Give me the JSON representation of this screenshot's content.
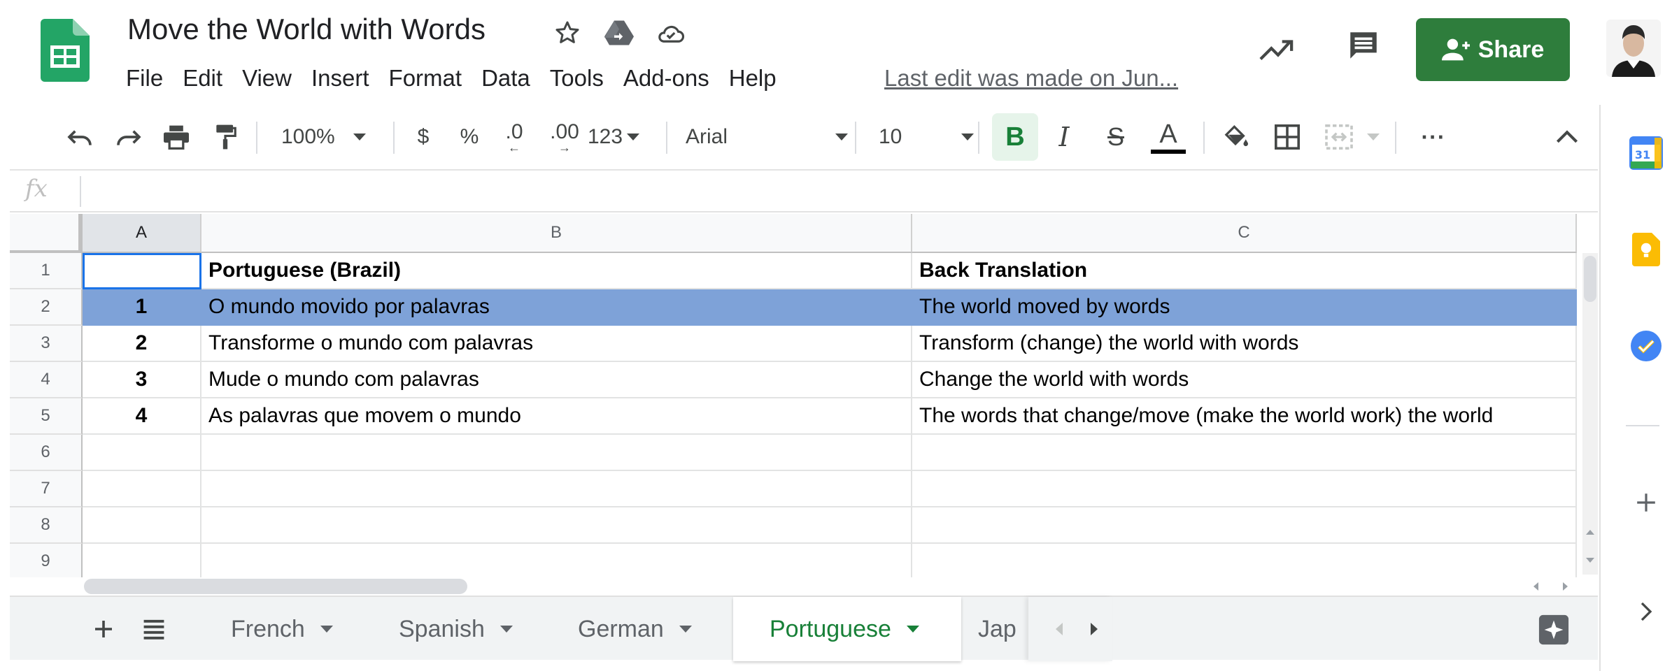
{
  "header": {
    "title": "Move the World with Words",
    "last_edit": "Last edit was made on Jun...",
    "share_label": "Share",
    "menu": [
      "File",
      "Edit",
      "View",
      "Insert",
      "Format",
      "Data",
      "Tools",
      "Add-ons",
      "Help"
    ]
  },
  "toolbar": {
    "zoom": "100%",
    "currency": "$",
    "percent": "%",
    "dec_decrease": ".0",
    "dec_increase": ".00",
    "more_formats": "123",
    "font": "Arial",
    "font_size": "10",
    "bold": "B",
    "italic": "I",
    "strike": "S",
    "text_color": "A",
    "more": "···"
  },
  "formula_bar": {
    "fx": "fx"
  },
  "grid": {
    "columns": [
      "A",
      "B",
      "C"
    ],
    "rows": [
      {
        "num": "1",
        "a": "",
        "b": "Portuguese (Brazil)",
        "c": "Back Translation"
      },
      {
        "num": "2",
        "a": "1",
        "b": "O mundo movido por palavras",
        "c": "The world moved by words"
      },
      {
        "num": "3",
        "a": "2",
        "b": "Transforme o mundo com palavras",
        "c": "Transform (change) the world with words"
      },
      {
        "num": "4",
        "a": "3",
        "b": "Mude o mundo com palavras",
        "c": "Change the world with words"
      },
      {
        "num": "5",
        "a": "4",
        "b": "As palavras que movem o mundo",
        "c": "The words that change/move (make the world work) the world"
      },
      {
        "num": "6",
        "a": "",
        "b": "",
        "c": ""
      },
      {
        "num": "7",
        "a": "",
        "b": "",
        "c": ""
      },
      {
        "num": "8",
        "a": "",
        "b": "",
        "c": ""
      },
      {
        "num": "9",
        "a": "",
        "b": "",
        "c": ""
      }
    ]
  },
  "sheets": {
    "tabs": [
      "French",
      "Spanish",
      "German",
      "Portuguese",
      "Jap"
    ],
    "active": "Portuguese"
  },
  "side_panel": {
    "calendar_day": "31"
  },
  "colors": {
    "share_green": "#2e7d3c",
    "selected_row": "#7ea2d8",
    "active_tab": "#188038"
  },
  "icons": [
    "sheets-logo-icon",
    "star-icon",
    "move-to-drive-icon",
    "cloud-saved-icon",
    "trending-icon",
    "comment-icon",
    "share-person-icon",
    "undo-icon",
    "redo-icon",
    "print-icon",
    "paint-format-icon",
    "fill-color-icon",
    "borders-icon",
    "merge-cells-icon",
    "collapse-icon",
    "add-sheet-icon",
    "all-sheets-icon",
    "explore-icon",
    "calendar-icon",
    "keep-icon",
    "tasks-icon",
    "add-icon",
    "chevron-right-icon"
  ]
}
